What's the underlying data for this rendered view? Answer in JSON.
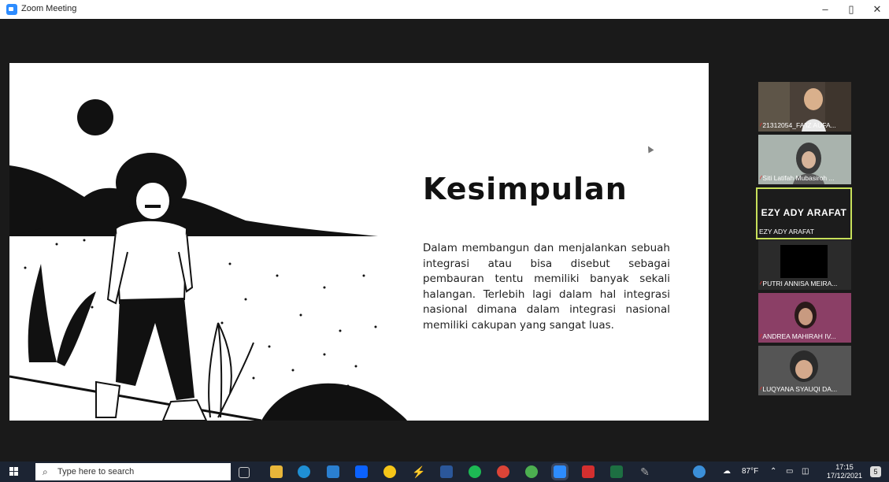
{
  "window": {
    "title": "Zoom Meeting",
    "minimize": "–",
    "restore": "▯",
    "close": "✕"
  },
  "slide": {
    "title": "Kesimpulan",
    "body": "Dalam membangun dan menjalankan sebuah integrasi atau bisa disebut sebagai pembauran tentu memiliki banyak sekali halangan. Terlebih lagi dalam hal integrasi nasional dimana dalam integrasi nasional memiliki cakupan yang sangat luas."
  },
  "participants": [
    {
      "name": "21312054_FA'IZ AUFA...",
      "muted": true,
      "video": "person-1"
    },
    {
      "name": "Siti Latifah Mubasiroh ...",
      "muted": true,
      "video": "person-2"
    },
    {
      "name": "EZY ADY ARAFAT",
      "display": "EZY ADY ARAFAT",
      "muted": false,
      "active": true
    },
    {
      "name": "PUTRI ANNISA MEIRA...",
      "muted": true,
      "video": "black"
    },
    {
      "name": "ANDREA MAHIRAH IV...",
      "muted": true,
      "video": "person-3"
    },
    {
      "name": "LUQYANA SYAUQI DA...",
      "muted": true,
      "video": "person-4"
    }
  ],
  "taskbar": {
    "search_placeholder": "Type here to search",
    "weather": "87°F",
    "time": "17:15",
    "date": "17/12/2021",
    "notification_count": "5"
  },
  "colors": {
    "accent_active": "#c7e05a",
    "zoom_blue": "#2d8cff",
    "mic_muted": "#e02a2a"
  }
}
